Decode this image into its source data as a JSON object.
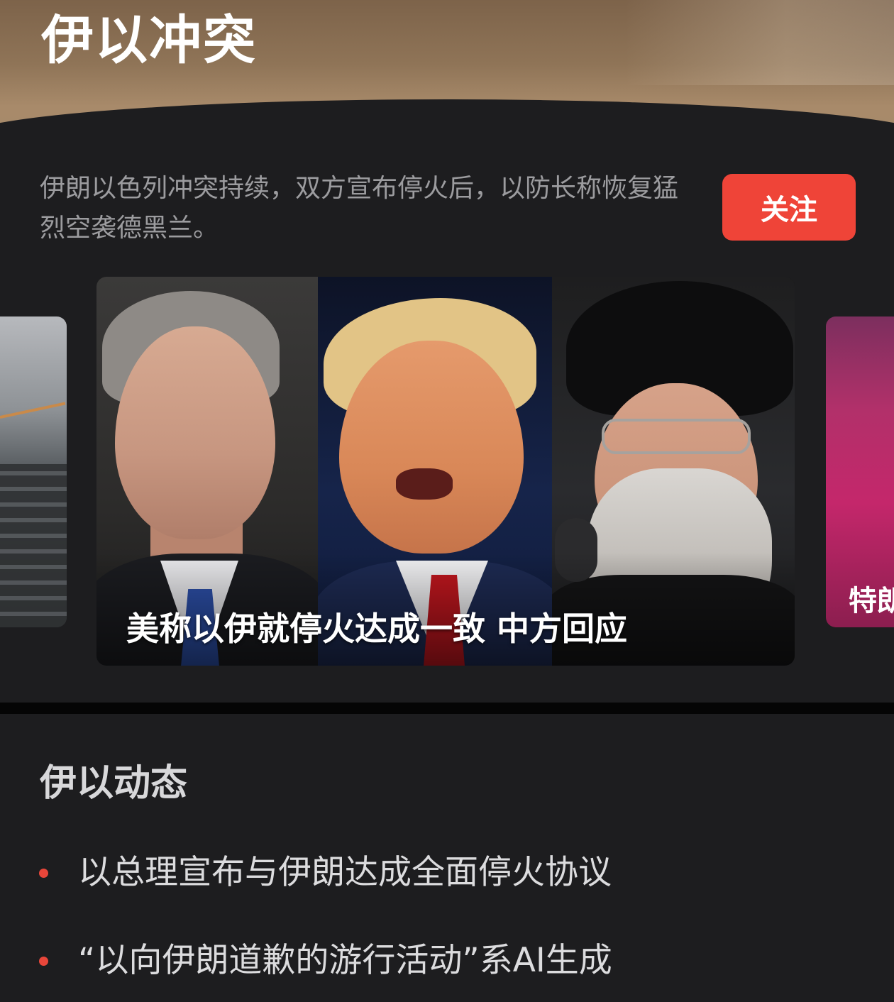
{
  "topic": {
    "title": "伊以冲突",
    "description": "伊朗以色列冲突持续，双方宣布停火后，以防长称恢复猛烈空袭德黑兰。",
    "follow_label": "关注"
  },
  "carousel": {
    "main_caption": "美称以伊就停火达成一致 中方回应",
    "right_caption": "特朗"
  },
  "updates": {
    "title": "伊以动态",
    "items": [
      "以总理宣布与伊朗达成全面停火协议",
      "“以向伊朗道歉的游行活动”系AI生成"
    ]
  },
  "colors": {
    "accent_red": "#ef4438",
    "background": "#1d1d1f",
    "banner": "#8f7457"
  }
}
